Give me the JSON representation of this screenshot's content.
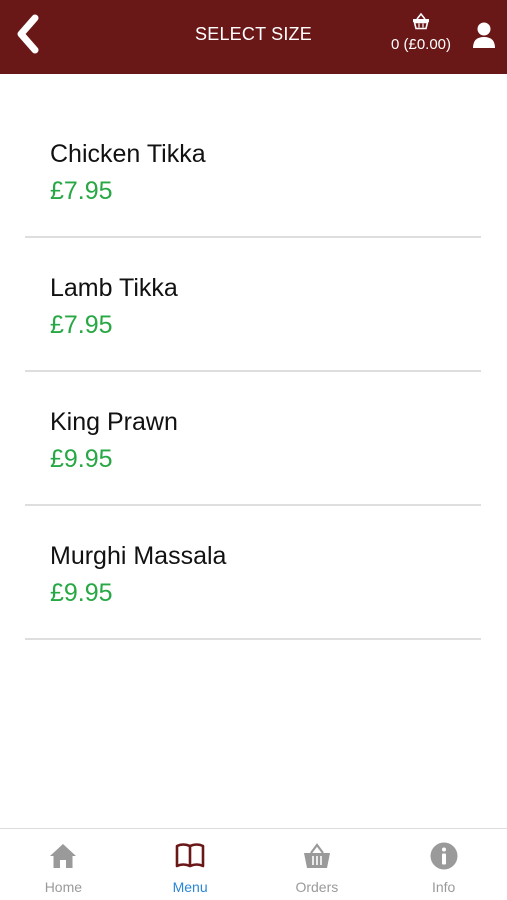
{
  "header": {
    "title": "SELECT SIZE",
    "basket_summary": "0 (£0.00)",
    "background": "#6a1718"
  },
  "items": [
    {
      "name": "Chicken Tikka",
      "price": "£7.95"
    },
    {
      "name": "Lamb Tikka",
      "price": "£7.95"
    },
    {
      "name": "King Prawn",
      "price": "£9.95"
    },
    {
      "name": "Murghi Massala",
      "price": "£9.95"
    }
  ],
  "tabs": [
    {
      "label": "Home",
      "icon": "home-icon",
      "active": false
    },
    {
      "label": "Menu",
      "icon": "book-icon",
      "active": true
    },
    {
      "label": "Orders",
      "icon": "basket-icon",
      "active": false
    },
    {
      "label": "Info",
      "icon": "info-icon",
      "active": false
    }
  ],
  "colors": {
    "price": "#27a844",
    "active_tab": "#2a86d6",
    "inactive_tab": "#9a9a9a",
    "menu_icon": "#6a1718"
  }
}
